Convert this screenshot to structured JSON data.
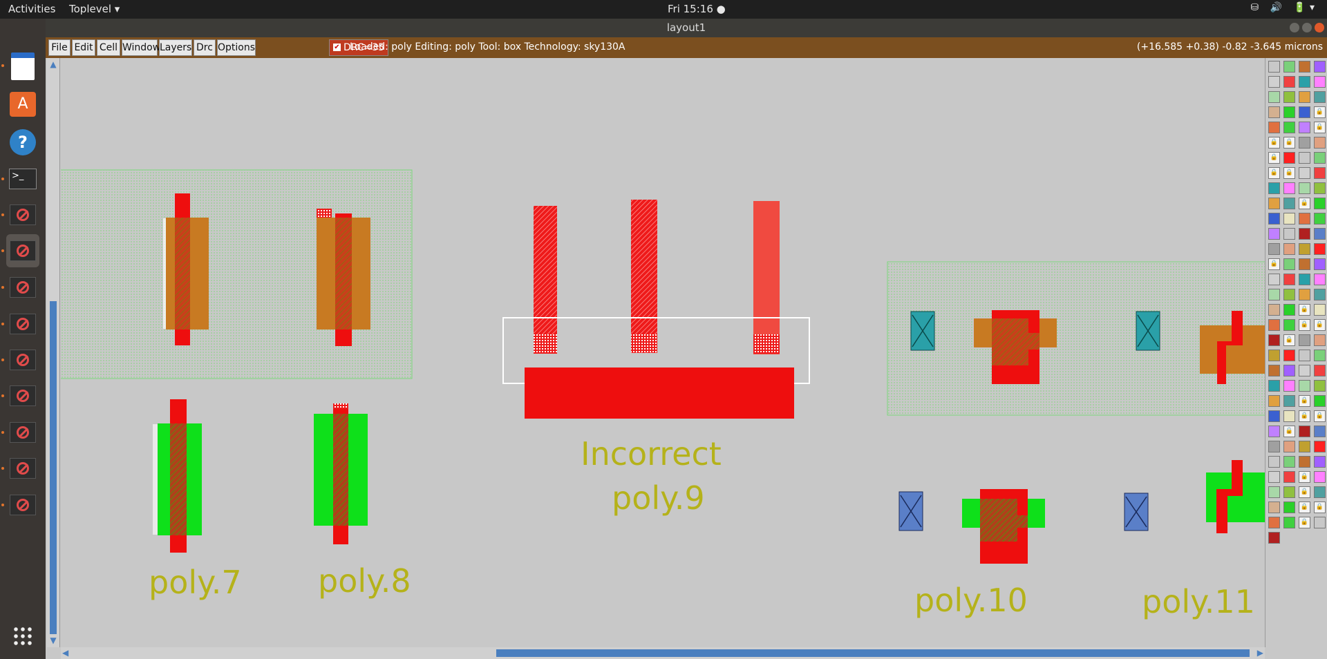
{
  "topbar": {
    "activities": "Activities",
    "app_menu": "Toplevel ▾",
    "clock": "Fri 15:16 ●",
    "tray": "⛁ 🔊 🔋▾"
  },
  "window": {
    "title": "layout1"
  },
  "menu": {
    "file": "File",
    "edit": "Edit",
    "cell": "Cell",
    "window": "Window",
    "layers": "Layers",
    "drc": "Drc",
    "options": "Options"
  },
  "drc_toggle": {
    "label": "DRC=35",
    "checked": true
  },
  "status": {
    "text": "Loaded: poly Editing: poly Tool: box  Technology: sky130A"
  },
  "coords": {
    "text": "(+16.585 +0.38) -0.82 -3.645 microns"
  },
  "labels": {
    "poly7": "poly.7",
    "poly8": "poly.8",
    "incorrect": "Incorrect",
    "poly9": "poly.9",
    "poly10": "poly.10",
    "poly11": "poly.11"
  },
  "colors": {
    "poly": "#ee0e0e",
    "diff": "#c87a22",
    "pdiff": "#0ee01a",
    "nwell_hatch": "#b7d9a8",
    "contact": "#2aa0a8",
    "menubar": "#7b4f1f",
    "label": "#b5b21a"
  }
}
